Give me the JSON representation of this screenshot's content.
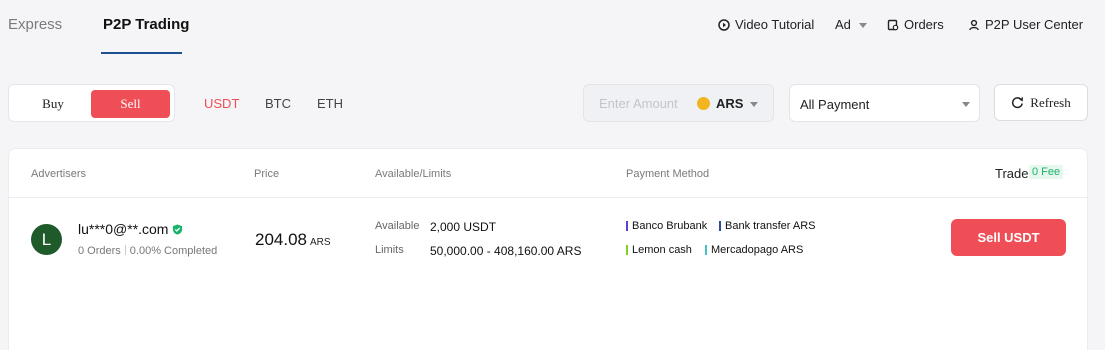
{
  "topnav": {
    "tabs": [
      "Express",
      "P2P Trading"
    ],
    "video_tutorial": "Video Tutorial",
    "ad": "Ad",
    "orders": "Orders",
    "user_center": "P2P User Center"
  },
  "filters": {
    "buy": "Buy",
    "sell": "Sell",
    "coins": [
      "USDT",
      "BTC",
      "ETH"
    ],
    "amount_placeholder": "Enter Amount",
    "currency": "ARS",
    "payment": "All Payment",
    "refresh": "Refresh"
  },
  "table": {
    "headers": {
      "advertisers": "Advertisers",
      "price": "Price",
      "available_limits": "Available/Limits",
      "payment_method": "Payment Method",
      "trade": "Trade",
      "fee": "0 Fee"
    },
    "rows": [
      {
        "avatar_letter": "L",
        "name": "lu***0@**.com",
        "orders": "0 Orders",
        "completed": "0.00% Completed",
        "price": "204.08",
        "price_currency": "ARS",
        "available_label": "Available",
        "available": "2,000 USDT",
        "limits_label": "Limits",
        "limits": "50,000.00 - 408,160.00 ARS",
        "payment_methods": [
          {
            "name": "Banco Brubank",
            "color": "#5b3fd6"
          },
          {
            "name": "Bank transfer ARS",
            "color": "#2b4aa8"
          },
          {
            "name": "Lemon cash",
            "color": "#7ed321"
          },
          {
            "name": "Mercadopago ARS",
            "color": "#48c0c8"
          }
        ],
        "action": "Sell USDT"
      }
    ]
  },
  "colors": {
    "accent": "#f04e57",
    "nav_underline": "#1d4f91",
    "verified": "#19b36b"
  }
}
